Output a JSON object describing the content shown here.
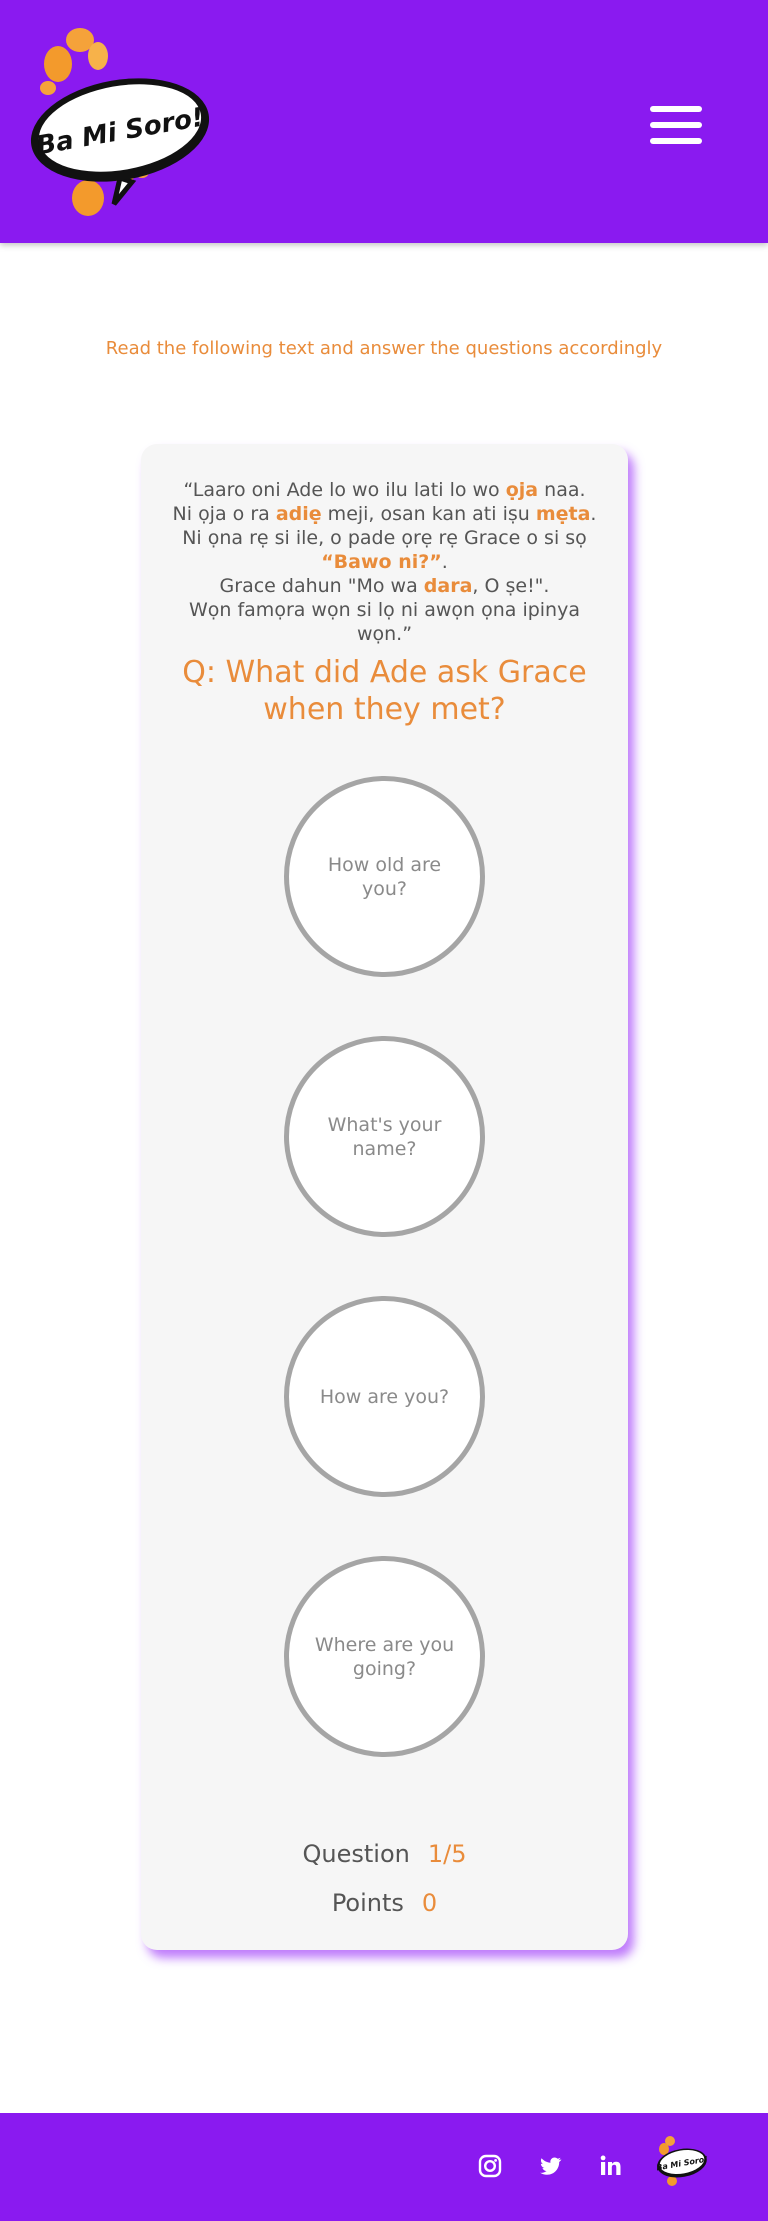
{
  "header": {
    "logo_text": "Ba Mi Soro!",
    "menu_icon": "hamburger-menu-icon"
  },
  "instruction": "Read the following text and answer the questions accordingly",
  "passage": {
    "lines": [
      [
        {
          "t": "“Laaro oni Ade lo wo ilu lati lo wo ",
          "hl": false
        },
        {
          "t": "ọja",
          "hl": true
        },
        {
          "t": " naa.",
          "hl": false
        }
      ],
      [
        {
          "t": "Ni ọja o ra ",
          "hl": false
        },
        {
          "t": "adiẹ",
          "hl": true
        },
        {
          "t": " meji, osan kan ati iṣu ",
          "hl": false
        },
        {
          "t": "mẹta",
          "hl": true
        },
        {
          "t": ".",
          "hl": false
        }
      ],
      [
        {
          "t": "Ni ọna rẹ si ile, o pade ọrẹ rẹ Grace o si sọ ",
          "hl": false
        },
        {
          "t": "“Bawo ni?”",
          "hl": true
        },
        {
          "t": ".",
          "hl": false
        }
      ],
      [
        {
          "t": "Grace dahun \"Mo wa ",
          "hl": false
        },
        {
          "t": "dara",
          "hl": true
        },
        {
          "t": ", O ṣe!\".",
          "hl": false
        }
      ],
      [
        {
          "t": "Wọn famọra wọn si lọ ni awọn ọna ipinya wọn.”",
          "hl": false
        }
      ]
    ]
  },
  "question": "Q: What did Ade ask Grace when they met?",
  "options": [
    {
      "label": "How old are you?"
    },
    {
      "label": "What's your name?"
    },
    {
      "label": "How are you?"
    },
    {
      "label": "Where are you going?"
    }
  ],
  "stats": {
    "question_label": "Question",
    "question_value": "1/5",
    "points_label": "Points",
    "points_value": "0"
  },
  "footer": {
    "icons": [
      "instagram-icon",
      "twitter-icon",
      "linkedin-icon"
    ],
    "logo_text": "Ba Mi Soro!"
  },
  "colors": {
    "brand_purple": "#8a1af0",
    "accent_orange": "#e98c3b"
  }
}
